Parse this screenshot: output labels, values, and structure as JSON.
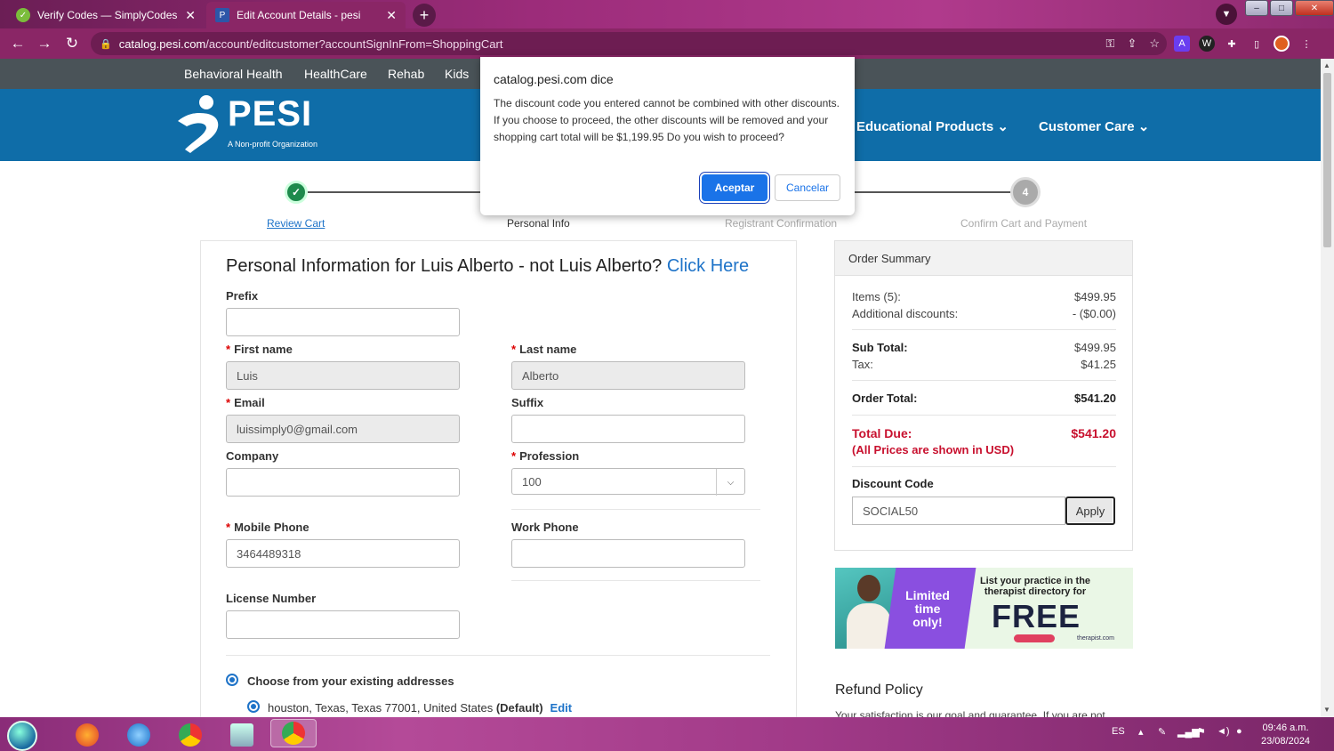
{
  "browser": {
    "tabs": [
      {
        "title": "Verify Codes — SimplyCodes",
        "close": "✕"
      },
      {
        "title": "Edit Account Details - pesi",
        "close": "✕"
      }
    ],
    "url_host": "catalog.pesi.com",
    "url_path": "/account/editcustomer?accountSignInFrom=ShoppingCart"
  },
  "site_nav": {
    "top_links": [
      "Behavioral Health",
      "HealthCare",
      "Rehab",
      "Kids"
    ],
    "logo_name": "PESI",
    "logo_sub": "A Non-profit Organization",
    "main_links": [
      "Educational Products",
      "Customer Care"
    ]
  },
  "steps": {
    "step1": "Review Cart",
    "step2": "Personal Info",
    "step3": "Registrant Confirmation",
    "step4": "Confirm Cart and Payment",
    "step4_num": "4"
  },
  "form": {
    "title": "Personal Information for Luis Alberto - not Luis Alberto?",
    "title_link": "Click Here",
    "prefix_label": "Prefix",
    "first_name_label": "First name",
    "first_name_value": "Luis",
    "last_name_label": "Last name",
    "last_name_value": "Alberto",
    "email_label": "Email",
    "email_value": "luissimply0@gmail.com",
    "suffix_label": "Suffix",
    "company_label": "Company",
    "profession_label": "Profession",
    "profession_value": "100",
    "mobile_label": "Mobile Phone",
    "mobile_value": "3464489318",
    "work_label": "Work Phone",
    "license_label": "License Number",
    "choose_address": "Choose from your existing addresses",
    "address_text": "houston, Texas, Texas 77001, United States",
    "address_default": "(Default)",
    "address_edit": "Edit"
  },
  "order_summary": {
    "title": "Order Summary",
    "items_label": "Items (5):",
    "items_value": "$499.95",
    "addl_label": "Additional discounts:",
    "addl_value": "- ($0.00)",
    "subtotal_label": "Sub Total:",
    "subtotal_value": "$499.95",
    "tax_label": "Tax:",
    "tax_value": "$41.25",
    "order_total_label": "Order Total:",
    "order_total_value": "$541.20",
    "total_due_label": "Total Due:",
    "total_due_value": "$541.20",
    "usd_note": "(All Prices are shown in USD)",
    "discount_label": "Discount Code",
    "discount_value": "SOCIAL50",
    "apply_label": "Apply"
  },
  "ad": {
    "limited": "Limited time only!",
    "list_text": "List your practice in the therapist directory for",
    "free": "FREE",
    "brand": "therapist.com"
  },
  "refund": {
    "title": "Refund Policy",
    "text": "Your satisfaction is our goal and guarantee. If you are not"
  },
  "dialog": {
    "title": "catalog.pesi.com dice",
    "message": "The discount code you entered cannot be combined with other discounts. If you choose to proceed, the other discounts will be removed and your shopping cart total will be $1,199.95 Do you wish to proceed?",
    "ok": "Aceptar",
    "cancel": "Cancelar"
  },
  "taskbar": {
    "lang": "ES",
    "time": "09:46 a.m.",
    "date": "23/08/2024"
  },
  "colors": {
    "brand_blue": "#0f6da8",
    "chrome_tab": "#8a2666",
    "accent_red": "#c8102e",
    "link_blue": "#1e73c8"
  }
}
